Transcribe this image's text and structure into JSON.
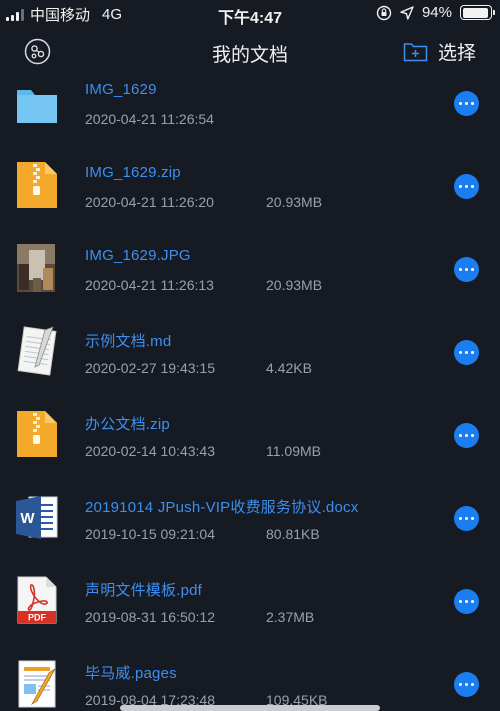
{
  "status_bar": {
    "carrier": "中国移动",
    "network": "4G",
    "time": "下午4:47",
    "battery_percent": "94%",
    "battery_level": 0.94
  },
  "nav_bar": {
    "title": "我的文档",
    "select_label": "选择"
  },
  "files": [
    {
      "name": "IMG_1629",
      "date": "2020-04-21 11:26:54",
      "size": "",
      "type": "folder-icon"
    },
    {
      "name": "IMG_1629.zip",
      "date": "2020-04-21 11:26:20",
      "size": "20.93MB",
      "type": "zip-file-icon"
    },
    {
      "name": "IMG_1629.JPG",
      "date": "2020-04-21 11:26:13",
      "size": "20.93MB",
      "type": "image-thumbnail"
    },
    {
      "name": "示例文档.md",
      "date": "2020-02-27 19:43:15",
      "size": "4.42KB",
      "type": "text-file-icon"
    },
    {
      "name": "办公文档.zip",
      "date": "2020-02-14 10:43:43",
      "size": "11.09MB",
      "type": "zip-file-icon"
    },
    {
      "name": "20191014 JPush-VIP收费服务协议.docx",
      "date": "2019-10-15 09:21:04",
      "size": "80.81KB",
      "type": "word-file-icon"
    },
    {
      "name": "声明文件模板.pdf",
      "date": "2019-08-31 16:50:12",
      "size": "2.37MB",
      "type": "pdf-file-icon"
    },
    {
      "name": "毕马威.pages",
      "date": "2019-08-04 17:23:48",
      "size": "109.45KB",
      "type": "pages-file-icon"
    }
  ],
  "icons": {
    "pdf_label": "PDF",
    "word_label": "W"
  },
  "colors": {
    "background": "#161a22",
    "link_blue": "#3d8ff0",
    "accent_blue": "#1a7ef0",
    "folder_blue": "#5bb8ef",
    "zip_orange": "#f4a92a"
  }
}
